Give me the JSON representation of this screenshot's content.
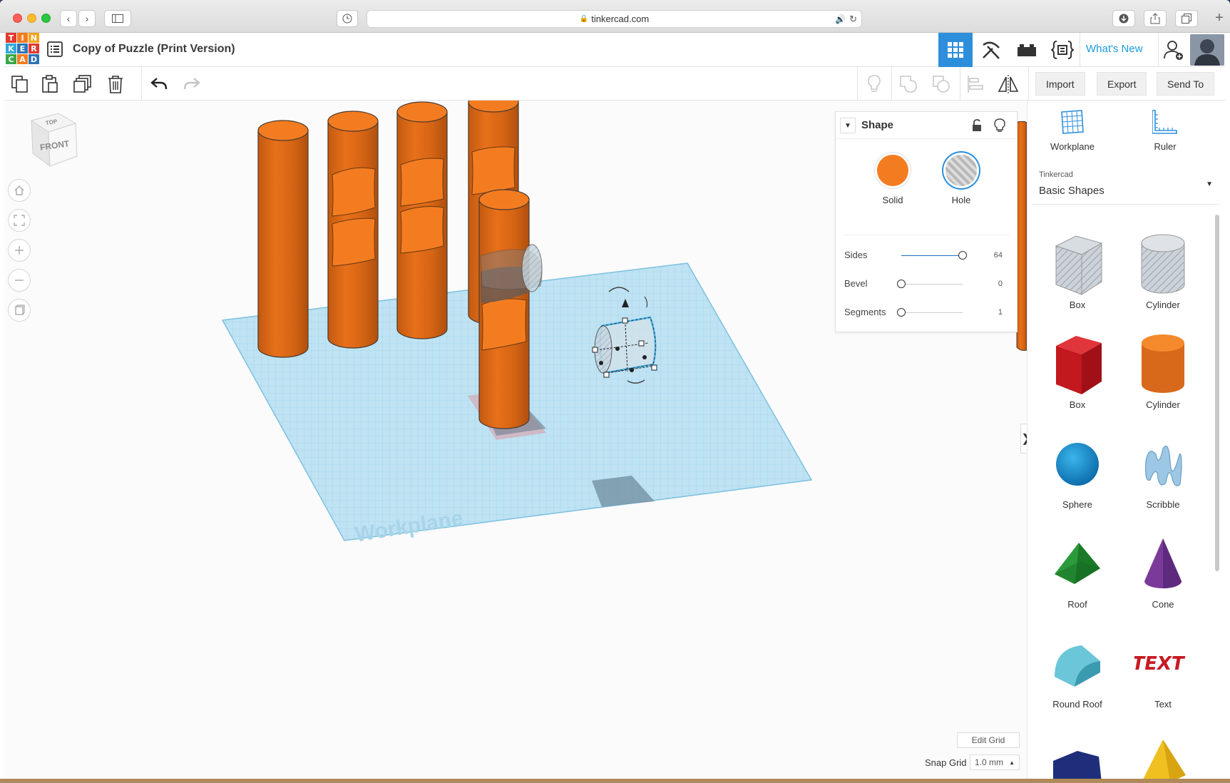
{
  "browser": {
    "url": "tinkercad.com"
  },
  "header": {
    "logo_letters": [
      "T",
      "I",
      "N",
      "K",
      "E",
      "R",
      "C",
      "A",
      "D"
    ],
    "logo_colors": [
      "#e2382e",
      "#f47c20",
      "#f4a41c",
      "#2eaadc",
      "#2e74b8",
      "#e2382e",
      "#3aa846",
      "#f47c20",
      "#2e74b8"
    ],
    "doc_title": "Copy of Puzzle (Print Version)",
    "whats_new": "What's New"
  },
  "toolbar": {
    "import": "Import",
    "export": "Export",
    "send_to": "Send To"
  },
  "viewcube": {
    "top": "TOP",
    "front": "FRONT"
  },
  "workplane_watermark": "Workplane",
  "inspector": {
    "title": "Shape",
    "solid_label": "Solid",
    "hole_label": "Hole",
    "params": [
      {
        "label": "Sides",
        "value": "64",
        "level": 1.0
      },
      {
        "label": "Bevel",
        "value": "0",
        "level": 0.0
      },
      {
        "label": "Segments",
        "value": "1",
        "level": 0.0
      }
    ],
    "accent": "#f47c20"
  },
  "right_panel": {
    "workplane_label": "Workplane",
    "ruler_label": "Ruler",
    "library_source": "Tinkercad",
    "library_name": "Basic Shapes",
    "shapes": [
      {
        "label": "Box",
        "icon": "box-hole-icon"
      },
      {
        "label": "Cylinder",
        "icon": "cylinder-hole-icon"
      },
      {
        "label": "Box",
        "icon": "box-red-icon"
      },
      {
        "label": "Cylinder",
        "icon": "cylinder-orange-icon"
      },
      {
        "label": "Sphere",
        "icon": "sphere-icon"
      },
      {
        "label": "Scribble",
        "icon": "scribble-icon"
      },
      {
        "label": "Roof",
        "icon": "roof-icon"
      },
      {
        "label": "Cone",
        "icon": "cone-icon"
      },
      {
        "label": "Round Roof",
        "icon": "round-roof-icon"
      },
      {
        "label": "Text",
        "icon": "text-shape-icon"
      }
    ]
  },
  "footer": {
    "edit_grid": "Edit Grid",
    "snap_grid_label": "Snap Grid",
    "snap_grid_value": "1.0 mm"
  },
  "colors": {
    "orange": "#f47c20",
    "workplane": "#9fd6ee",
    "accent_blue": "#1a9ce0"
  }
}
